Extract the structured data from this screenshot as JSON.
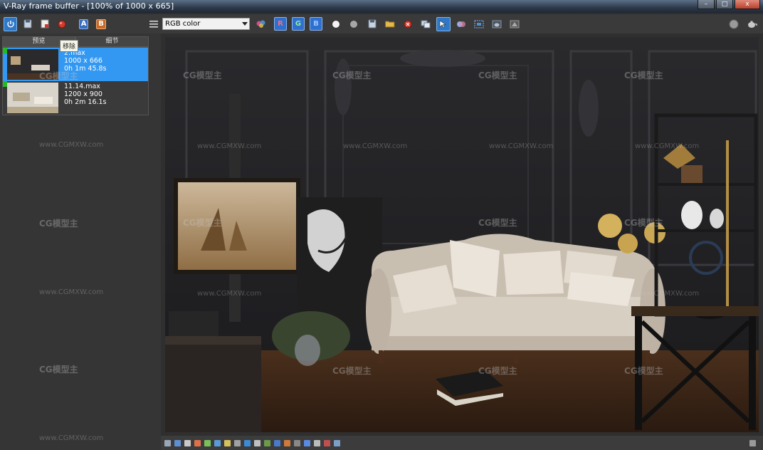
{
  "window": {
    "title": "V-Ray frame buffer - [100% of 1000 x 665]",
    "min_label": "–",
    "max_label": "□",
    "close_label": "x"
  },
  "left_toolbar": {
    "buttons": [
      {
        "icon": "power-icon"
      },
      {
        "icon": "save-icon"
      },
      {
        "icon": "load-icon"
      },
      {
        "icon": "remove-icon"
      },
      {
        "icon": "compare-a-icon",
        "label": "A"
      },
      {
        "icon": "compare-b-icon",
        "label": "B"
      }
    ],
    "menu_icon": "menu-icon"
  },
  "main_toolbar": {
    "channel_select": "RGB color",
    "channel_buttons": [
      {
        "label": "R"
      },
      {
        "label": "G"
      },
      {
        "label": "B"
      }
    ]
  },
  "history": {
    "tabs": [
      "预览",
      "细节"
    ],
    "tooltip": "移除",
    "items": [
      {
        "line1": "2.max",
        "line2": "1000 x 666",
        "line3": "0h 1m 45.8s",
        "selected": true
      },
      {
        "line1": "11.14.max",
        "line2": "1200 x 900",
        "line3": "0h 2m 16.1s",
        "selected": false
      }
    ]
  },
  "canvas": {
    "watermark_logo": "CG模型主",
    "watermark_url": "www.CGMXW.com"
  },
  "colors": {
    "accent": "#3398f2",
    "channel_button": "#2f6fcf"
  }
}
